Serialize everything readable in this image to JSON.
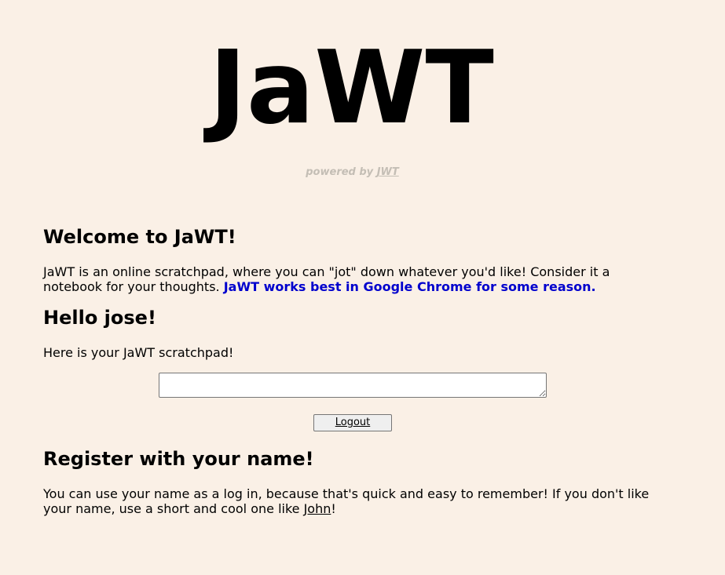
{
  "header": {
    "logo": "JaWT",
    "powered_prefix": "powered by ",
    "powered_link": "JWT"
  },
  "welcome": {
    "heading": "Welcome to JaWT!",
    "text": " JaWT is an online scratchpad, where you can \"jot\" down whatever you'd like! Consider it a notebook for your thoughts. ",
    "highlight": "JaWT works best in Google Chrome for some reason."
  },
  "hello": {
    "heading": "Hello jose!",
    "text": " Here is your JaWT scratchpad!",
    "scratchpad_value": "",
    "logout_label": "Logout"
  },
  "register": {
    "heading": "Register with your name!",
    "text": " You can use your name as a log in, because that's quick and easy to remember! If you don't like your name, use a short and cool one like ",
    "example_name": "John",
    "suffix": "!"
  },
  "colors": {
    "background": "#faf0e6",
    "highlight": "#0000cd",
    "powered": "#c4beb5"
  }
}
